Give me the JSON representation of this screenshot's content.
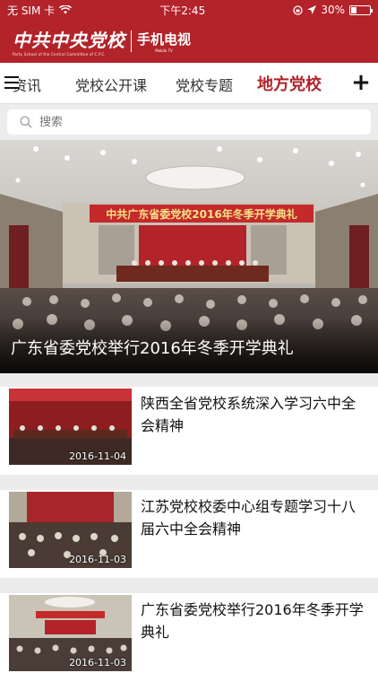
{
  "status_bar": {
    "carrier": "无 SIM 卡",
    "time": "下午2:45",
    "battery": "30%",
    "battery_level": 0.3
  },
  "header": {
    "logo_main": "中共中央党校",
    "logo_sub": "Party School of the Central Committee of C.P.C",
    "logo_tv": "手机电视",
    "logo_tv_sub": "Mobile TV"
  },
  "nav": {
    "tabs": [
      {
        "label": "资讯",
        "active": false
      },
      {
        "label": "党校公开课",
        "active": false
      },
      {
        "label": "党校专题",
        "active": false
      },
      {
        "label": "地方党校",
        "active": true
      }
    ],
    "menu_icon": "hamburger-icon",
    "add_icon": "plus-icon"
  },
  "search": {
    "placeholder": "搜索",
    "icon": "search-icon"
  },
  "hero": {
    "banner_text": "中共广东省委党校2016年冬季开学典礼",
    "caption": "广东省委党校举行2016年冬季开学典礼"
  },
  "news": [
    {
      "title": "陕西全省党校系统深入学习六中全会精神",
      "date": "2016-11-04"
    },
    {
      "title": "江苏党校校委中心组专题学习十八届六中全会精神",
      "date": "2016-11-03"
    },
    {
      "title": "广东省委党校举行2016年冬季开学典礼",
      "date": "2016-11-03"
    }
  ],
  "colors": {
    "brand_red": "#b3232a",
    "active_tab": "#b3232a"
  }
}
